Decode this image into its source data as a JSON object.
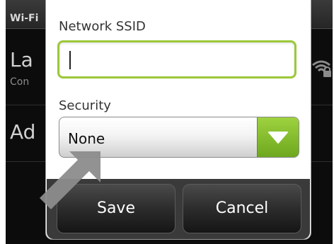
{
  "background": {
    "header_title": "Wi-Fi",
    "rows": [
      {
        "title": "La",
        "subtitle": "Con"
      },
      {
        "title": "Ad",
        "subtitle": ""
      }
    ]
  },
  "dialog": {
    "ssid_label": "Network SSID",
    "ssid_value": "",
    "security_label": "Security",
    "security_selected": "None",
    "buttons": {
      "save": "Save",
      "cancel": "Cancel"
    }
  },
  "colors": {
    "accent_green": "#8dc63f",
    "dialog_bg": "#ffffff",
    "button_bar": "#3a3a3a",
    "pointer_arrow": "#8c8c8c"
  },
  "icons": {
    "wifi": "wifi-secured-icon",
    "dropdown": "chevron-down-icon",
    "pointer": "pointer-arrow-icon"
  }
}
